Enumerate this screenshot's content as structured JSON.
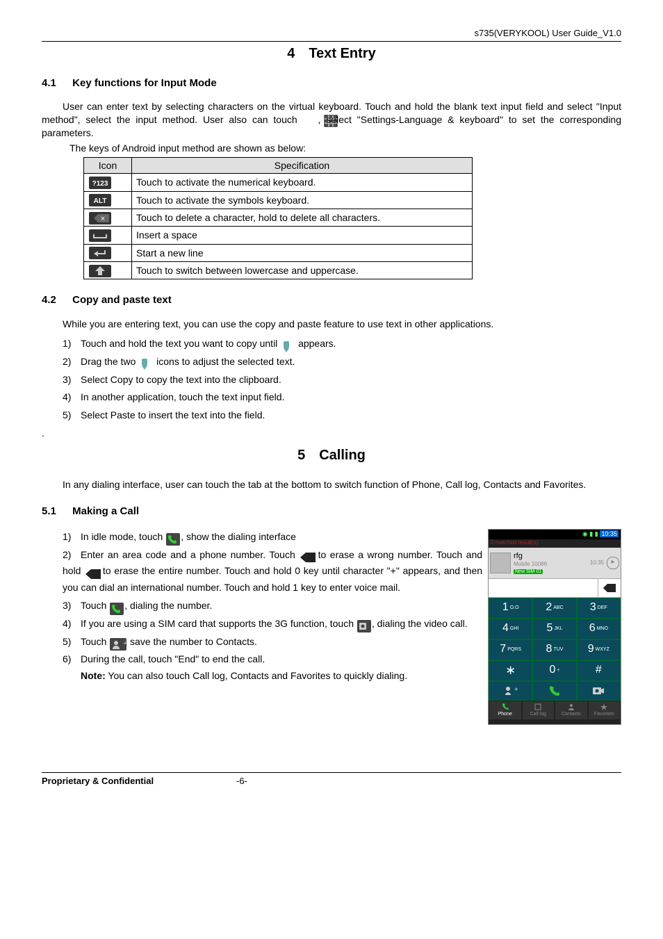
{
  "header": {
    "right": "s735(VERYKOOL) User Guide_V1.0"
  },
  "chapter4": {
    "title": "4 Text Entry"
  },
  "section41": {
    "heading_num": "4.1",
    "heading_text": "Key functions for Input Mode",
    "para": "User can enter text by selecting characters on the virtual keyboard. Touch and hold the blank text input field and select \"Input method\", select the input method. User also can touch",
    "para_tail": ", select \"Settings-Language & keyboard\" to set the corresponding parameters.",
    "table_intro": "The keys of Android input method are shown as below:",
    "table": {
      "h1": "Icon",
      "h2": "Specification",
      "rows": [
        "Touch to activate the numerical keyboard.",
        "Touch to activate the symbols keyboard.",
        "Touch to delete a character, hold to delete all characters.",
        "Insert a space",
        "Start a new line",
        "Touch to switch between lowercase and uppercase."
      ]
    }
  },
  "section42": {
    "heading_num": "4.2",
    "heading_text": "Copy and paste text",
    "para": "While you are entering text, you can use the copy and paste feature to use text in other applications.",
    "items": {
      "i1a": "Touch and hold the text you want to copy until",
      "i1b": " appears.",
      "i2a": "Drag the two",
      "i2b": " icons to adjust the selected text.",
      "i3": "Select Copy to copy the text into the clipboard.",
      "i4": "In another application, touch the text input field.",
      "i5": "Select Paste to insert the text into the field."
    }
  },
  "chapter5": {
    "title": "5 Calling",
    "intro": "In any dialing interface, user can touch the tab at the bottom to switch function of Phone, Call log, Contacts and Favorites."
  },
  "section51": {
    "heading_num": "5.1",
    "heading_text": "Making a Call",
    "items": {
      "i1a": "In idle mode, touch",
      "i1b": ", show the dialing interface",
      "i2a": "Enter an area code and a phone number. Touch",
      "i2b": " to erase a wrong number. Touch  and hold",
      "i2c": " to erase the entire number. Touch and hold 0 key until character \"+\" appears, and then you can dial an international number. Touch and hold 1 key to enter voice mail.",
      "i3a": "Touch",
      "i3b": ", dialing the number.",
      "i4a": "If you are using a SIM card that supports the 3G function, touch",
      "i4b": ", dialing the video call.",
      "i5a": "Touch",
      "i5b": ", save the number to Contacts.",
      "i6": "During the call, touch \"End\" to end the call.",
      "note_label": "Note:",
      "note_text": " You can also touch Call log, Contacts and Favorites to quickly dialing."
    }
  },
  "phone": {
    "time": "10:35",
    "contact_name": "rfg",
    "contact_sub1": "Mobile 10086",
    "contact_sub2": "New SIM 01",
    "match": "0 matched result(s)",
    "sub_time": "10:35",
    "keys": {
      "k1": "1",
      "k1s": "O.O",
      "k2": "2",
      "k2s": "ABC",
      "k3": "3",
      "k3s": "DEF",
      "k4": "4",
      "k4s": "GHI",
      "k5": "5",
      "k5s": "JKL",
      "k6": "6",
      "k6s": "MNO",
      "k7": "7",
      "k7s": "PQRS",
      "k8": "8",
      "k8s": "TUV",
      "k9": "9",
      "k9s": "WXYZ",
      "kstar": "∗",
      "k0": "0",
      "k0s": "+",
      "khash": "#"
    },
    "tabs": {
      "t1": "Phone",
      "t2": "Call log",
      "t3": "Contacts",
      "t4": "Favorites"
    }
  },
  "footer": {
    "left": "Proprietary & Confidential",
    "page": "-6-"
  }
}
